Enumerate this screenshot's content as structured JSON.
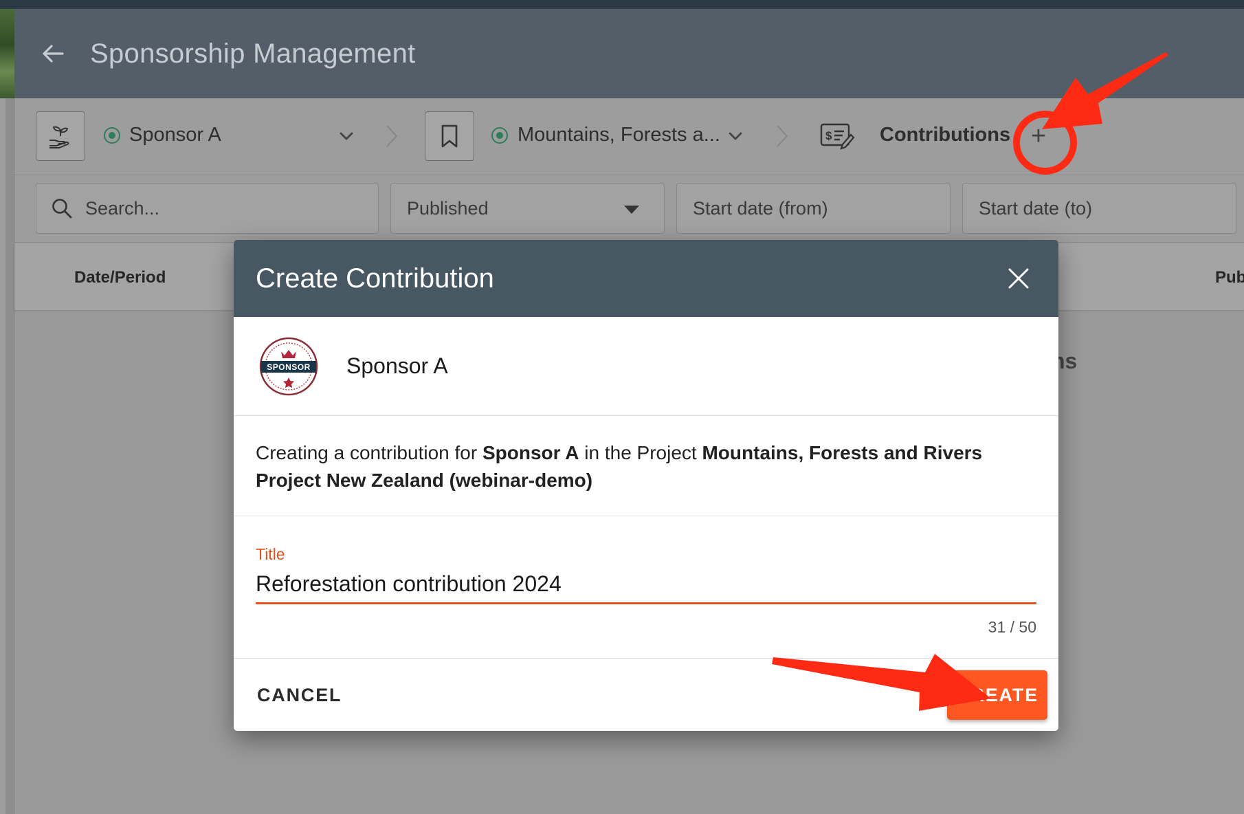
{
  "header": {
    "title": "Sponsorship Management"
  },
  "breadcrumbs": {
    "sponsor": {
      "label": "Sponsor A"
    },
    "project": {
      "label": "Mountains, Forests a..."
    },
    "section": {
      "label": "Contributions",
      "add_symbol": "+"
    }
  },
  "filters": {
    "search_placeholder": "Search...",
    "status_value": "Published",
    "start_from_placeholder": "Start date (from)",
    "start_to_placeholder": "Start date (to)"
  },
  "table": {
    "columns": [
      "Date/Period",
      "Pub"
    ],
    "behind_text": "ns"
  },
  "modal": {
    "title": "Create Contribution",
    "sponsor_name": "Sponsor A",
    "avatar_text": "SPONSOR",
    "description": {
      "prefix": "Creating a contribution for ",
      "sponsor": "Sponsor A",
      "middle": " in the Project ",
      "project": "Mountains, Forests and Rivers Project New Zealand (webinar-demo)"
    },
    "field": {
      "label": "Title",
      "value": "Reforestation contribution 2024",
      "counter": "31 / 50"
    },
    "actions": {
      "cancel": "CANCEL",
      "create": "CREATE"
    }
  },
  "colors": {
    "header_bg": "#535e68",
    "modal_header_bg": "#475863",
    "accent": "#ff5722",
    "field_accent": "#e0531f",
    "annotation": "#ff2a14",
    "status_green": "#2e7d5a"
  },
  "icons": [
    "back-arrow-icon",
    "plant-hand-icon",
    "chevron-down-icon",
    "chevron-right-icon",
    "bookmark-icon",
    "contribution-invoice-icon",
    "plus-icon",
    "search-icon",
    "caret-down-icon",
    "close-icon"
  ]
}
